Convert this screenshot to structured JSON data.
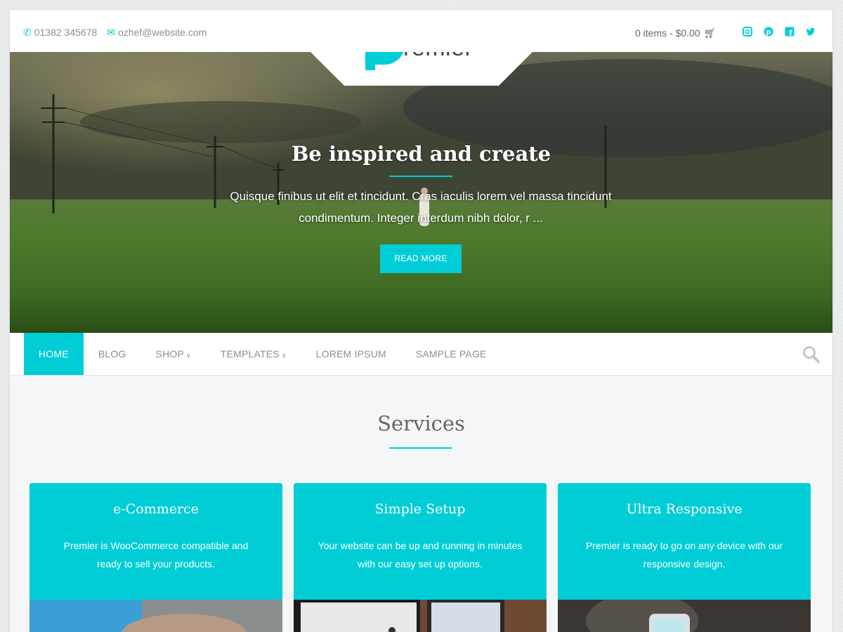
{
  "topbar": {
    "phone": "01382 345678",
    "email": "ozhef@website.com",
    "cart": "0 items - $0.00",
    "social": [
      "instagram-icon",
      "pinterest-icon",
      "facebook-icon",
      "twitter-icon"
    ]
  },
  "brand": {
    "logo_letter": "p",
    "logo_text": "remier",
    "accent": "#00cdd6"
  },
  "hero": {
    "title": "Be inspired and create",
    "text": "Quisque finibus ut elit et tincidunt. Cras iaculis lorem vel massa tincidunt condimentum. Integer interdum nibh dolor, r ...",
    "button": "READ MORE"
  },
  "nav": {
    "items": [
      {
        "label": "HOME",
        "active": true
      },
      {
        "label": "BLOG"
      },
      {
        "label": "SHOP",
        "dropdown": true
      },
      {
        "label": "TEMPLATES",
        "dropdown": true
      },
      {
        "label": "LOREM IPSUM"
      },
      {
        "label": "SAMPLE PAGE"
      }
    ]
  },
  "services": {
    "title": "Services",
    "cards": [
      {
        "title": "e-Commerce",
        "text": "Premier is WooCommerce compatible and ready to sell your products."
      },
      {
        "title": "Simple Setup",
        "text": "Your website can be up and running in minutes with our easy set up options."
      },
      {
        "title": "Ultra Responsive",
        "text": "Premier is ready to go on any device with our responsive design."
      }
    ]
  }
}
